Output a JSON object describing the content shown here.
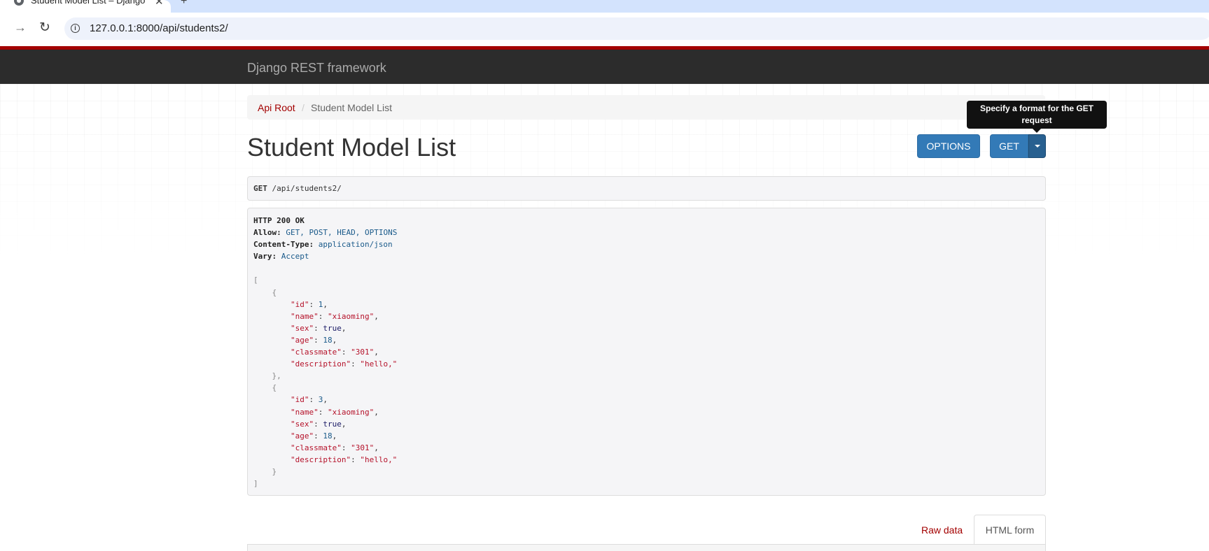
{
  "browser": {
    "tab_title": "Student Model List – Django REST framework",
    "tab_close": "✕",
    "new_tab": "+",
    "url": "127.0.0.1:8000/api/students2/"
  },
  "navbar": {
    "brand": "Django REST framework"
  },
  "breadcrumb": {
    "root": "Api Root",
    "separator": "/",
    "current": "Student Model List"
  },
  "tooltip": {
    "line1": "Specify a format for the GET",
    "line2": "request"
  },
  "page": {
    "title": "Student Model List"
  },
  "buttons": {
    "options": "OPTIONS",
    "get": "GET"
  },
  "request": {
    "method": "GET",
    "path": "/api/students2/"
  },
  "response": {
    "status": "HTTP 200 OK",
    "headers": [
      {
        "name": "Allow:",
        "value": "GET, POST, HEAD, OPTIONS"
      },
      {
        "name": "Content-Type:",
        "value": "application/json"
      },
      {
        "name": "Vary:",
        "value": "Accept"
      }
    ],
    "records": [
      {
        "id": "1",
        "name": "\"xiaoming\"",
        "sex": "true",
        "age": "18",
        "classmate": "\"301\"",
        "description": "\"hello,\""
      },
      {
        "id": "3",
        "name": "\"xiaoming\"",
        "sex": "true",
        "age": "18",
        "classmate": "\"301\"",
        "description": "\"hello,\""
      }
    ],
    "keys": {
      "id": "\"id\"",
      "name": "\"name\"",
      "sex": "\"sex\"",
      "age": "\"age\"",
      "classmate": "\"classmate\"",
      "description": "\"description\""
    }
  },
  "form_tabs": {
    "raw": "Raw data",
    "html": "HTML form"
  }
}
